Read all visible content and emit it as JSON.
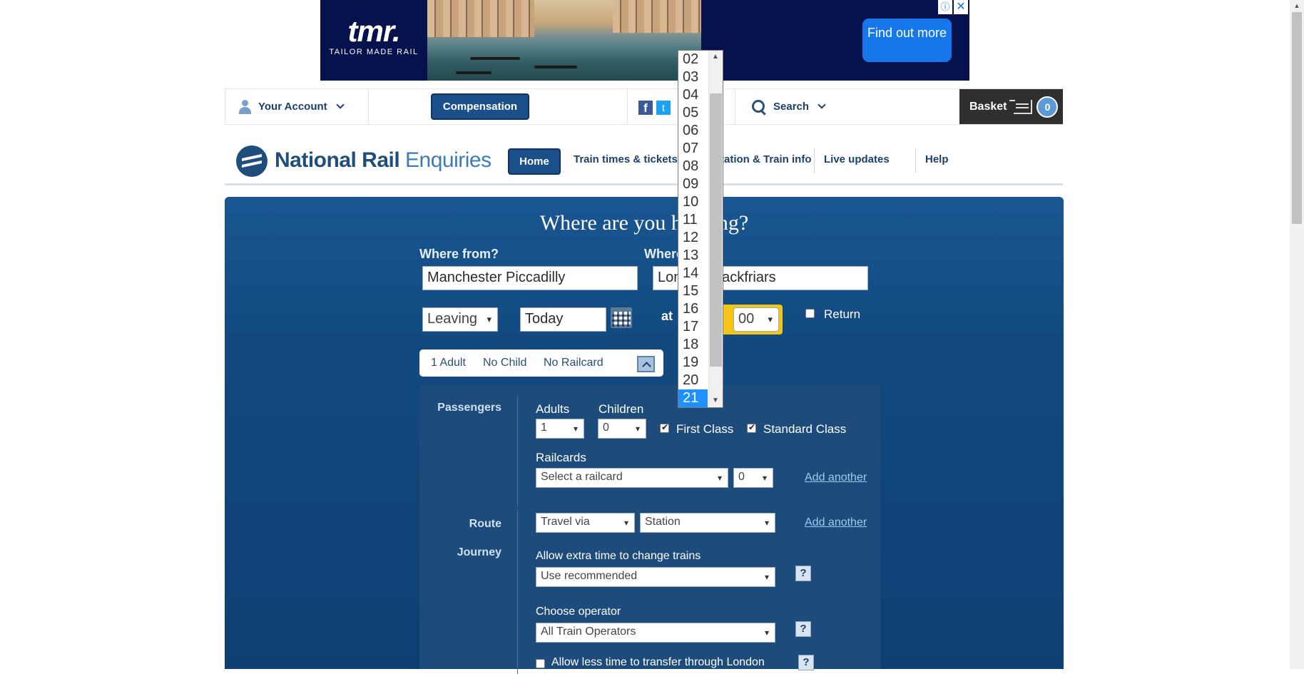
{
  "ad": {
    "brand": "tmr.",
    "tagline": "TAILOR MADE RAIL",
    "cta": "Find out more",
    "info_icon": "ⓘ",
    "close_icon": "✕"
  },
  "topbar": {
    "account_label": "Your Account",
    "compensation_label": "Compensation",
    "facebook_icon": "f",
    "twitter_icon": "t",
    "search_label": "Search",
    "basket_label": "Basket",
    "basket_count": "0"
  },
  "nav": {
    "brand_main": "National Rail",
    "brand_sub": "Enquiries",
    "home": "Home",
    "train_times": "Train times & tickets",
    "station_info": "Station & Train info",
    "live_updates": "Live updates",
    "help": "Help"
  },
  "journey": {
    "headline": "Where are you heading?",
    "from_label": "Where from?",
    "from_value": "Manchester Piccadilly",
    "to_label": "Where to?",
    "to_value": "London Blackfriars",
    "leaving_option": "Leaving",
    "date_value": "Today",
    "at_label": "at",
    "minute_value": "00",
    "return_label": "Return",
    "summary": {
      "adults": "1 Adult",
      "children": "No Child",
      "railcard": "No Railcard"
    }
  },
  "options": {
    "passengers_label": "Passengers",
    "adults_label": "Adults",
    "adults_value": "1",
    "children_label": "Children",
    "children_value": "0",
    "first_class_label": "First Class",
    "standard_class_label": "Standard Class",
    "railcards_label": "Railcards",
    "railcard_placeholder": "Select a railcard",
    "railcard_count": "0",
    "add_another_1": "Add another",
    "route_label": "Route",
    "travel_via": "Travel via",
    "station_placeholder": "Station",
    "add_another_2": "Add another",
    "journey_label": "Journey",
    "extra_time_label": "Allow extra time to change trains",
    "extra_time_value": "Use recommended",
    "operator_label": "Choose operator",
    "operator_value": "All Train Operators",
    "less_time_label": "Allow less time to transfer through London",
    "help_icon": "?"
  },
  "hour_dropdown": {
    "options": [
      "02",
      "03",
      "04",
      "05",
      "06",
      "07",
      "08",
      "09",
      "10",
      "11",
      "12",
      "13",
      "14",
      "15",
      "16",
      "17",
      "18",
      "19",
      "20",
      "21"
    ],
    "selected": "21",
    "scroll_up": "▲",
    "scroll_down": "▼"
  },
  "colors": {
    "panel_blue": "#124a80",
    "brand_navy": "#1b4f8a",
    "highlight": "#1e90ff",
    "time_highlight": "#f5c515"
  }
}
